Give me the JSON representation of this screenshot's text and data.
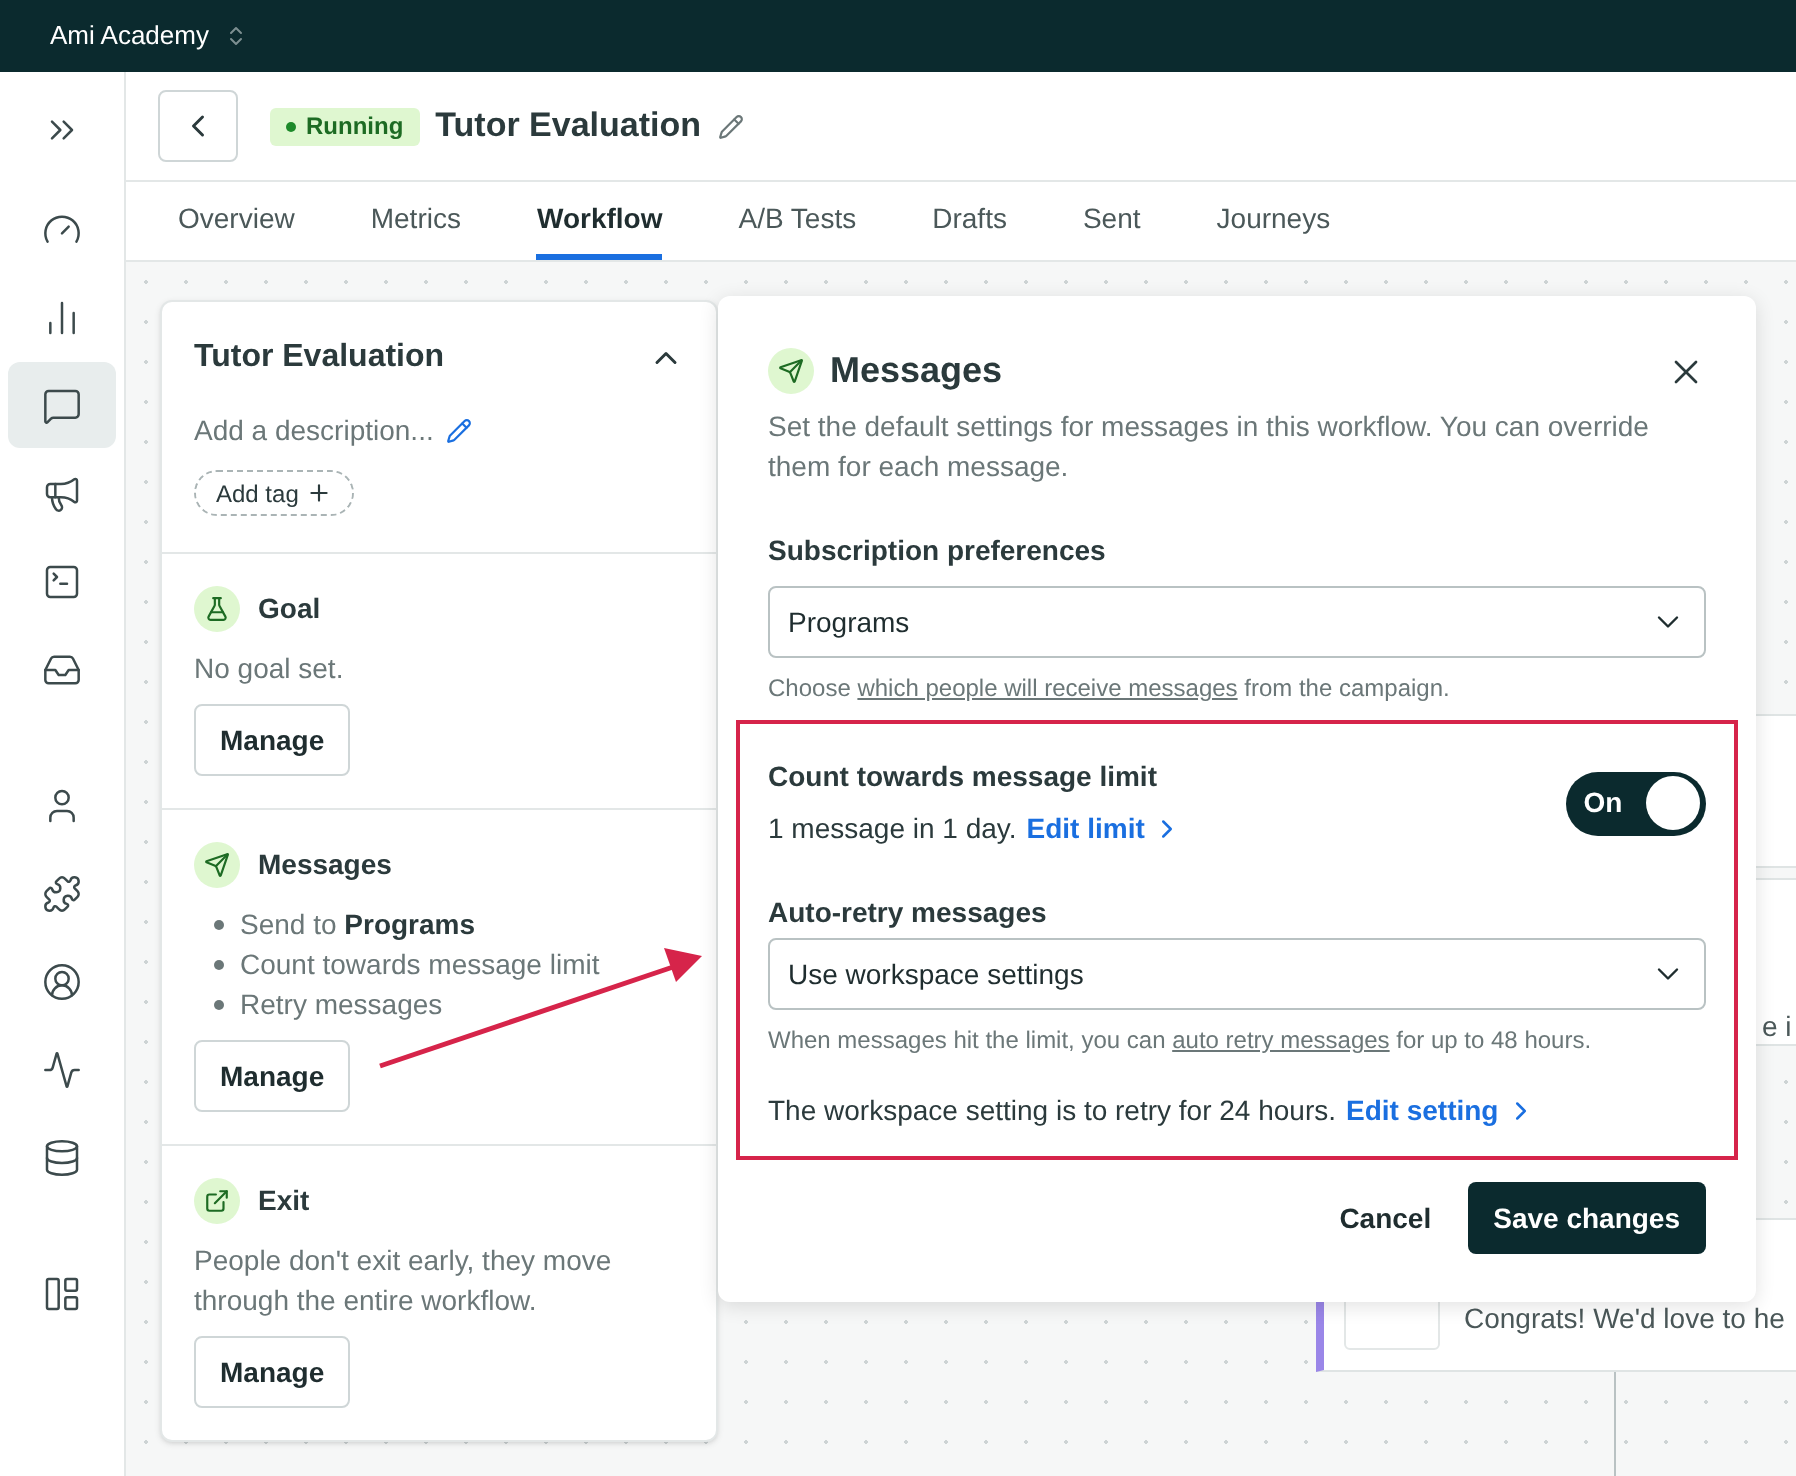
{
  "workspace": {
    "name": "Ami Academy"
  },
  "nav_rail": [
    {
      "selected": false
    },
    {
      "selected": false
    },
    {
      "selected": false
    },
    {
      "selected": true
    },
    {
      "selected": false
    },
    {
      "selected": false
    },
    {
      "selected": false
    },
    {
      "selected": false
    },
    {
      "selected": false
    },
    {
      "selected": false
    },
    {
      "selected": false
    },
    {
      "selected": false
    },
    {
      "selected": false
    }
  ],
  "header": {
    "status": "Running",
    "title": "Tutor Evaluation"
  },
  "tabs": [
    {
      "label": "Overview",
      "selected": false
    },
    {
      "label": "Metrics",
      "selected": false
    },
    {
      "label": "Workflow",
      "selected": true
    },
    {
      "label": "A/B Tests",
      "selected": false
    },
    {
      "label": "Drafts",
      "selected": false
    },
    {
      "label": "Sent",
      "selected": false
    },
    {
      "label": "Journeys",
      "selected": false
    }
  ],
  "summary": {
    "title": "Tutor Evaluation",
    "description_placeholder": "Add a description...",
    "tag_button": "Add tag",
    "sections": [
      {
        "kind": "goal",
        "title": "Goal",
        "text": "No goal set.",
        "button": "Manage"
      },
      {
        "kind": "messages",
        "title": "Messages",
        "bullets": [
          "Send to **Programs**",
          "Count towards message limit",
          "Retry messages"
        ],
        "button": "Manage"
      },
      {
        "kind": "exit",
        "title": "Exit",
        "text": "People don't exit early, they move through the entire workflow.",
        "button": "Manage"
      }
    ]
  },
  "modal": {
    "title": "Messages",
    "description": "Set the default settings for messages in this workflow. You can override them for each message.",
    "subscription": {
      "label": "Subscription preferences",
      "value": "Programs",
      "hint": {
        "before": "Choose ",
        "link": "which people will receive messages",
        "after": " from the campaign."
      }
    },
    "message_limit": {
      "label": "Count towards message limit",
      "text": "1 message in 1 day.",
      "link": "Edit limit",
      "toggle": {
        "on": true,
        "label": "On"
      }
    },
    "auto_retry": {
      "label": "Auto-retry messages",
      "value": "Use workspace settings",
      "hint": {
        "before": "When messages hit the limit, you can ",
        "link": "auto retry messages",
        "after": " for up to 48 hours."
      },
      "note": "The workspace setting is to retry for 24 hours.",
      "link": "Edit setting"
    },
    "buttons": {
      "cancel": "Cancel",
      "save": "Save changes"
    }
  },
  "background_nodes": [
    {
      "text": "e i"
    },
    {
      "text": "Congrats! We'd love to he"
    }
  ]
}
